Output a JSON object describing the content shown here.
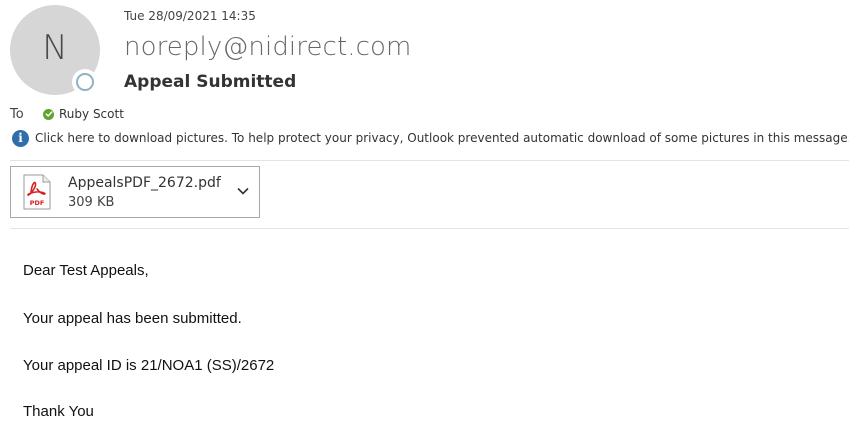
{
  "header": {
    "avatar_initial": "N",
    "timestamp": "Tue 28/09/2021 14:35",
    "sender": "noreply@nidirect.com",
    "subject": "Appeal Submitted"
  },
  "recipients": {
    "to_label": "To",
    "name": "Ruby Scott"
  },
  "info_bar": {
    "text": "Click here to download pictures. To help protect your privacy, Outlook prevented automatic download of some pictures in this message."
  },
  "attachment": {
    "file_name": "AppealsPDF_2672.pdf",
    "file_size": "309 KB",
    "icon_label": "PDF"
  },
  "body": {
    "greeting": "Dear Test Appeals,",
    "line1": "Your appeal has been submitted.",
    "line2": "Your appeal ID is 21/NOA1 (SS)/2672",
    "closing": "Thank You"
  },
  "colors": {
    "avatar_bg": "#d6d6d6",
    "presence_ring": "#8fb3c4",
    "check_green": "#5ea52b",
    "info_blue": "#2f6eab",
    "pdf_red": "#d6201c"
  },
  "icons": [
    "presence-status-icon",
    "check-icon",
    "info-icon",
    "pdf-icon",
    "chevron-down-icon"
  ]
}
